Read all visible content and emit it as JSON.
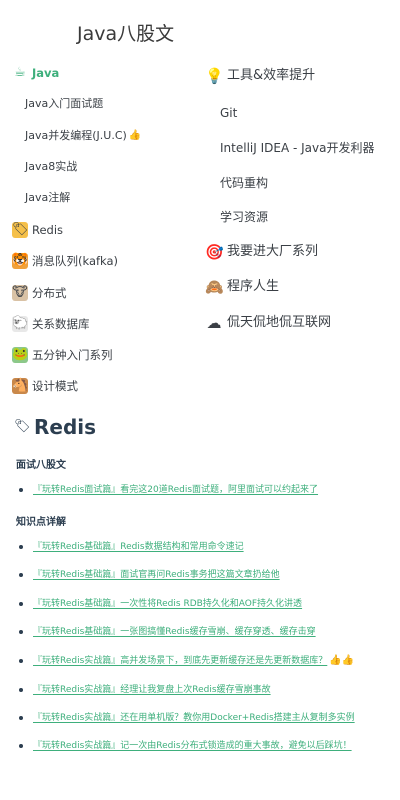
{
  "site_title": "Java八股文",
  "nav_left": [
    {
      "emoji": "☕",
      "label": "Java",
      "type": "top",
      "active": true,
      "emoji_bg": ""
    },
    {
      "label": "Java入门面试题",
      "type": "sub"
    },
    {
      "label": "Java并发编程(J.U.C)",
      "type": "sub",
      "suffix": "👍"
    },
    {
      "label": "Java8实战",
      "type": "sub"
    },
    {
      "label": "Java注解",
      "type": "sub"
    },
    {
      "emoji": "🏷",
      "label": "Redis",
      "type": "top",
      "emoji_bg": "#f5c04a"
    },
    {
      "emoji": "🐯",
      "label": "消息队列(kafka)",
      "type": "top",
      "emoji_bg": "#f0a13c"
    },
    {
      "emoji": "🐮",
      "label": "分布式",
      "type": "top",
      "emoji_bg": "#d9c2a5"
    },
    {
      "emoji": "🐑",
      "label": "关系数据库",
      "type": "top",
      "emoji_bg": "#e8e8e8"
    },
    {
      "emoji": "🐸",
      "label": "五分钟入门系列",
      "type": "top",
      "emoji_bg": "#8cc88a"
    },
    {
      "emoji": "🐴",
      "label": "设计模式",
      "type": "top",
      "emoji_bg": "#c9884a"
    }
  ],
  "nav_right": [
    {
      "emoji": "💡",
      "label": "工具&效率提升",
      "type": "top"
    },
    {
      "label": "Git",
      "type": "sub"
    },
    {
      "label": "IntelliJ IDEA - Java开发利器",
      "type": "sub"
    },
    {
      "label": "代码重构",
      "type": "sub"
    },
    {
      "label": "学习资源",
      "type": "sub"
    },
    {
      "emoji": "🎯",
      "label": "我要进大厂系列",
      "type": "top"
    },
    {
      "emoji": "🙈",
      "label": "程序人生",
      "type": "top"
    },
    {
      "emoji": "☁",
      "label": "侃天侃地侃互联网",
      "type": "top"
    }
  ],
  "article": {
    "emoji": "🏷",
    "title": "Redis",
    "sections": [
      {
        "heading": "面试八股文",
        "links": [
          {
            "text": "『玩转Redis面试篇』看完这20道Redis面试题，阿里面试可以约起来了"
          }
        ]
      },
      {
        "heading": "知识点详解",
        "links": [
          {
            "text": "『玩转Redis基础篇』Redis数据结构和常用命令速记"
          },
          {
            "text": "『玩转Redis基础篇』面试官再问Redis事务把这篇文章扔给他"
          },
          {
            "text": "『玩转Redis基础篇』一次性将Redis RDB持久化和AOF持久化讲透"
          },
          {
            "text": "『玩转Redis基础篇』一张图搞懂Redis缓存雪崩、缓存穿透、缓存击穿"
          },
          {
            "text": "『玩转Redis实战篇』高并发场景下，到底先更新缓存还是先更新数据库？",
            "suffix": "👍👍"
          },
          {
            "text": "『玩转Redis实战篇』经理让我复盘上次Redis缓存雪崩事故"
          },
          {
            "text": "『玩转Redis实战篇』还在用单机版？教你用Docker+Redis搭建主从复制多实例"
          },
          {
            "text": "『玩转Redis实战篇』记一次由Redis分布式锁造成的重大事故，避免以后踩坑！"
          }
        ]
      }
    ]
  }
}
